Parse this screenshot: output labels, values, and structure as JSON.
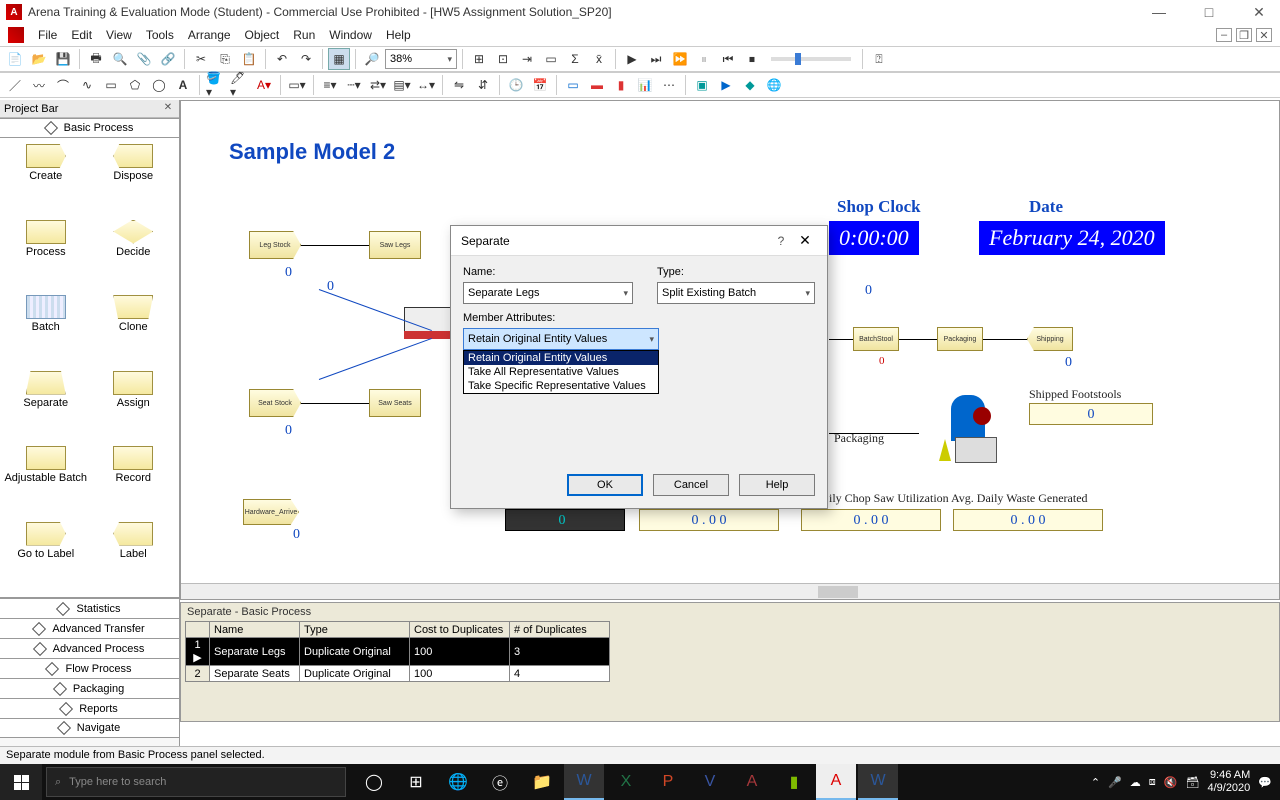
{
  "title": "Arena Training & Evaluation Mode (Student) - Commercial Use Prohibited - [HW5 Assignment Solution_SP20]",
  "menus": [
    "File",
    "Edit",
    "View",
    "Tools",
    "Arrange",
    "Object",
    "Run",
    "Window",
    "Help"
  ],
  "zoom": "38%",
  "projectbar": {
    "header": "Project Bar",
    "active_panel": "Basic Process",
    "modules": [
      {
        "label": "Create",
        "shape": "sh-trap-r"
      },
      {
        "label": "Dispose",
        "shape": "sh-trap-l"
      },
      {
        "label": "Process",
        "shape": "sh-rect"
      },
      {
        "label": "Decide",
        "shape": "sh-diamond"
      },
      {
        "label": "Batch",
        "shape": "sh-batch"
      },
      {
        "label": "Clone",
        "shape": "sh-trapezoid2"
      },
      {
        "label": "Separate",
        "shape": "sh-trapezoid"
      },
      {
        "label": "Assign",
        "shape": "sh-rect"
      },
      {
        "label": "Adjustable Batch",
        "shape": "sh-rect"
      },
      {
        "label": "Record",
        "shape": "sh-rect"
      },
      {
        "label": "Go to Label",
        "shape": "sh-trap-r"
      },
      {
        "label": "Label",
        "shape": "sh-trap-l"
      }
    ],
    "panels": [
      "Statistics",
      "Advanced Transfer",
      "Advanced Process",
      "Flow Process",
      "Packaging",
      "Reports",
      "Navigate"
    ]
  },
  "model": {
    "title": "Sample Model 2",
    "shop_clock_label": "Shop Clock",
    "shop_clock": "0:00:00",
    "date_label": "Date",
    "date": "February 24, 2020",
    "blocks": {
      "leg_stock": "Leg Stock",
      "saw_legs": "Saw Legs",
      "seat_stock": "Seat Stock",
      "saw_seats": "Saw Seats",
      "hardware": "Hardware_Arrive",
      "batchstool": "BatchStool",
      "packaging": "Packaging",
      "shipping": "Shipping",
      "to_packaging": "Packaging",
      "shipped_label": "Shipped Footstools",
      "shipped_val": "0",
      "stat1_label": "ily Chop Saw Utilization",
      "stat1_val": "0 . 0 0",
      "stat2_label": "Avg. Daily Waste Generated",
      "stat2_val": "0 . 0 0",
      "hidden_stat": "0 . 0 0",
      "zero": "0"
    }
  },
  "dialog": {
    "title": "Separate",
    "name_label": "Name:",
    "name_value": "Separate Legs",
    "type_label": "Type:",
    "type_value": "Split Existing Batch",
    "member_label": "Member Attributes:",
    "member_value": "Retain Original Entity Values",
    "options": [
      "Retain Original Entity Values",
      "Take All Representative Values",
      "Take Specific Representative Values"
    ],
    "ok": "OK",
    "cancel": "Cancel",
    "help": "Help"
  },
  "sheet": {
    "title": "Separate - Basic Process",
    "cols": [
      "Name",
      "Type",
      "Cost to Duplicates",
      "# of Duplicates"
    ],
    "rows": [
      {
        "n": "1",
        "sel": true,
        "cells": [
          "Separate Legs",
          "Duplicate Original",
          "100",
          "3"
        ]
      },
      {
        "n": "2",
        "sel": false,
        "cells": [
          "Separate Seats",
          "Duplicate Original",
          "100",
          "4"
        ]
      }
    ]
  },
  "status": "Separate module from Basic Process panel selected.",
  "taskbar": {
    "search_placeholder": "Type here to search",
    "time": "9:46 AM",
    "date": "4/9/2020"
  }
}
